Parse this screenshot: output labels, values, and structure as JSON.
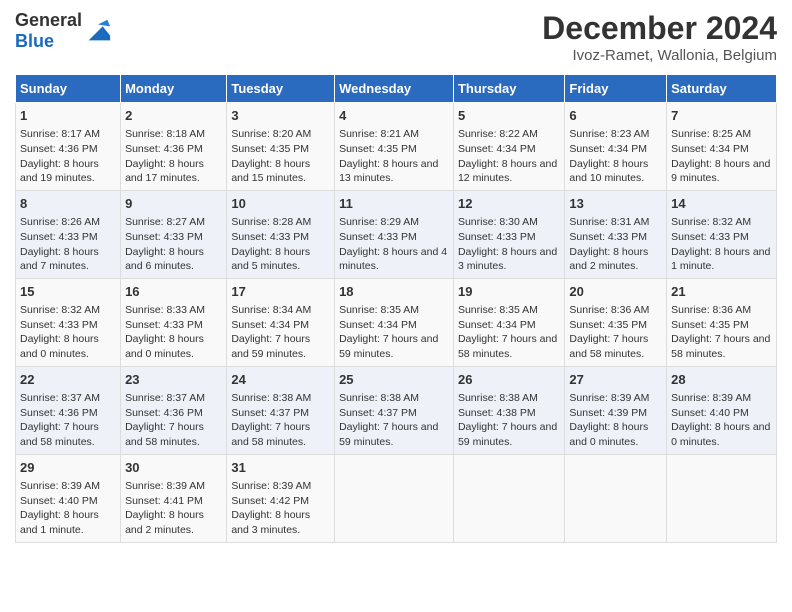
{
  "logo": {
    "text_general": "General",
    "text_blue": "Blue"
  },
  "title": "December 2024",
  "subtitle": "Ivoz-Ramet, Wallonia, Belgium",
  "days_of_week": [
    "Sunday",
    "Monday",
    "Tuesday",
    "Wednesday",
    "Thursday",
    "Friday",
    "Saturday"
  ],
  "weeks": [
    [
      {
        "day": 1,
        "info": "Sunrise: 8:17 AM\nSunset: 4:36 PM\nDaylight: 8 hours and 19 minutes."
      },
      {
        "day": 2,
        "info": "Sunrise: 8:18 AM\nSunset: 4:36 PM\nDaylight: 8 hours and 17 minutes."
      },
      {
        "day": 3,
        "info": "Sunrise: 8:20 AM\nSunset: 4:35 PM\nDaylight: 8 hours and 15 minutes."
      },
      {
        "day": 4,
        "info": "Sunrise: 8:21 AM\nSunset: 4:35 PM\nDaylight: 8 hours and 13 minutes."
      },
      {
        "day": 5,
        "info": "Sunrise: 8:22 AM\nSunset: 4:34 PM\nDaylight: 8 hours and 12 minutes."
      },
      {
        "day": 6,
        "info": "Sunrise: 8:23 AM\nSunset: 4:34 PM\nDaylight: 8 hours and 10 minutes."
      },
      {
        "day": 7,
        "info": "Sunrise: 8:25 AM\nSunset: 4:34 PM\nDaylight: 8 hours and 9 minutes."
      }
    ],
    [
      {
        "day": 8,
        "info": "Sunrise: 8:26 AM\nSunset: 4:33 PM\nDaylight: 8 hours and 7 minutes."
      },
      {
        "day": 9,
        "info": "Sunrise: 8:27 AM\nSunset: 4:33 PM\nDaylight: 8 hours and 6 minutes."
      },
      {
        "day": 10,
        "info": "Sunrise: 8:28 AM\nSunset: 4:33 PM\nDaylight: 8 hours and 5 minutes."
      },
      {
        "day": 11,
        "info": "Sunrise: 8:29 AM\nSunset: 4:33 PM\nDaylight: 8 hours and 4 minutes."
      },
      {
        "day": 12,
        "info": "Sunrise: 8:30 AM\nSunset: 4:33 PM\nDaylight: 8 hours and 3 minutes."
      },
      {
        "day": 13,
        "info": "Sunrise: 8:31 AM\nSunset: 4:33 PM\nDaylight: 8 hours and 2 minutes."
      },
      {
        "day": 14,
        "info": "Sunrise: 8:32 AM\nSunset: 4:33 PM\nDaylight: 8 hours and 1 minute."
      }
    ],
    [
      {
        "day": 15,
        "info": "Sunrise: 8:32 AM\nSunset: 4:33 PM\nDaylight: 8 hours and 0 minutes."
      },
      {
        "day": 16,
        "info": "Sunrise: 8:33 AM\nSunset: 4:33 PM\nDaylight: 8 hours and 0 minutes."
      },
      {
        "day": 17,
        "info": "Sunrise: 8:34 AM\nSunset: 4:34 PM\nDaylight: 7 hours and 59 minutes."
      },
      {
        "day": 18,
        "info": "Sunrise: 8:35 AM\nSunset: 4:34 PM\nDaylight: 7 hours and 59 minutes."
      },
      {
        "day": 19,
        "info": "Sunrise: 8:35 AM\nSunset: 4:34 PM\nDaylight: 7 hours and 58 minutes."
      },
      {
        "day": 20,
        "info": "Sunrise: 8:36 AM\nSunset: 4:35 PM\nDaylight: 7 hours and 58 minutes."
      },
      {
        "day": 21,
        "info": "Sunrise: 8:36 AM\nSunset: 4:35 PM\nDaylight: 7 hours and 58 minutes."
      }
    ],
    [
      {
        "day": 22,
        "info": "Sunrise: 8:37 AM\nSunset: 4:36 PM\nDaylight: 7 hours and 58 minutes."
      },
      {
        "day": 23,
        "info": "Sunrise: 8:37 AM\nSunset: 4:36 PM\nDaylight: 7 hours and 58 minutes."
      },
      {
        "day": 24,
        "info": "Sunrise: 8:38 AM\nSunset: 4:37 PM\nDaylight: 7 hours and 58 minutes."
      },
      {
        "day": 25,
        "info": "Sunrise: 8:38 AM\nSunset: 4:37 PM\nDaylight: 7 hours and 59 minutes."
      },
      {
        "day": 26,
        "info": "Sunrise: 8:38 AM\nSunset: 4:38 PM\nDaylight: 7 hours and 59 minutes."
      },
      {
        "day": 27,
        "info": "Sunrise: 8:39 AM\nSunset: 4:39 PM\nDaylight: 8 hours and 0 minutes."
      },
      {
        "day": 28,
        "info": "Sunrise: 8:39 AM\nSunset: 4:40 PM\nDaylight: 8 hours and 0 minutes."
      }
    ],
    [
      {
        "day": 29,
        "info": "Sunrise: 8:39 AM\nSunset: 4:40 PM\nDaylight: 8 hours and 1 minute."
      },
      {
        "day": 30,
        "info": "Sunrise: 8:39 AM\nSunset: 4:41 PM\nDaylight: 8 hours and 2 minutes."
      },
      {
        "day": 31,
        "info": "Sunrise: 8:39 AM\nSunset: 4:42 PM\nDaylight: 8 hours and 3 minutes."
      },
      null,
      null,
      null,
      null
    ]
  ]
}
